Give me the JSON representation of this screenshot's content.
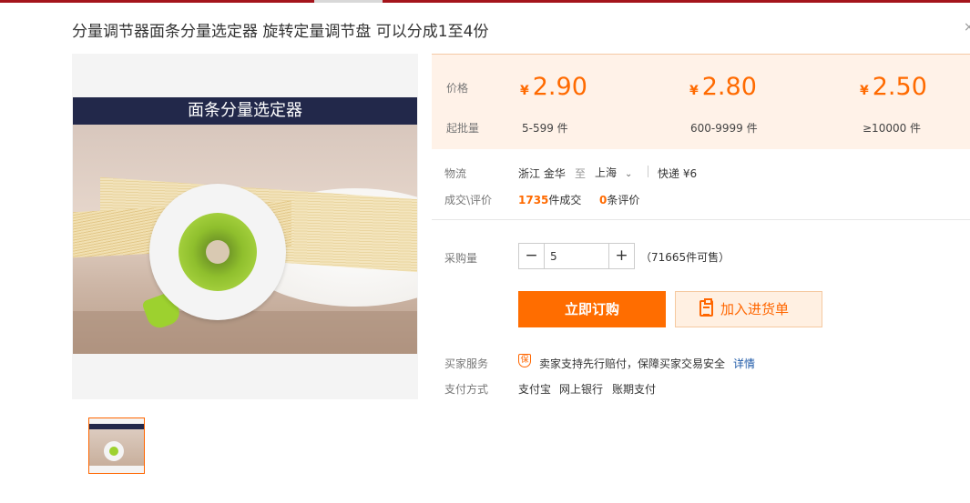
{
  "product": {
    "title": "分量调节器面条分量选定器 旋转定量调节盘 可以分成1至4份",
    "image_banner": "面条分量选定器"
  },
  "pricing": {
    "price_label": "价格",
    "moq_label": "起批量",
    "currency_symbol": "¥",
    "tiers": [
      {
        "price": "2.90",
        "range": "5-599 件"
      },
      {
        "price": "2.80",
        "range": "600-9999 件"
      },
      {
        "price": "2.50",
        "range": "≥10000 件"
      }
    ]
  },
  "logistics": {
    "label": "物流",
    "from": "浙江 金华",
    "to_word": "至",
    "to": "上海",
    "express": "快递 ¥6"
  },
  "deals": {
    "label": "成交\\评价",
    "count": "1735",
    "count_suffix": "件成交",
    "reviews": "0",
    "reviews_suffix": "条评价"
  },
  "purchase": {
    "label": "采购量",
    "quantity": "5",
    "available": "（71665件可售）",
    "buy_now": "立即订购",
    "add_to_list": "加入进货单"
  },
  "services": {
    "label": "买家服务",
    "shield_glyph": "保",
    "text": "卖家支持先行赔付，保障买家交易安全",
    "details_link": "详情"
  },
  "payment": {
    "label": "支付方式",
    "methods": [
      "支付宝",
      "网上银行",
      "账期支付"
    ]
  },
  "colors": {
    "accent": "#ff6a00",
    "topbar": "#a4141b",
    "price_bg": "#fff2e8",
    "link": "#1f5aa8"
  }
}
